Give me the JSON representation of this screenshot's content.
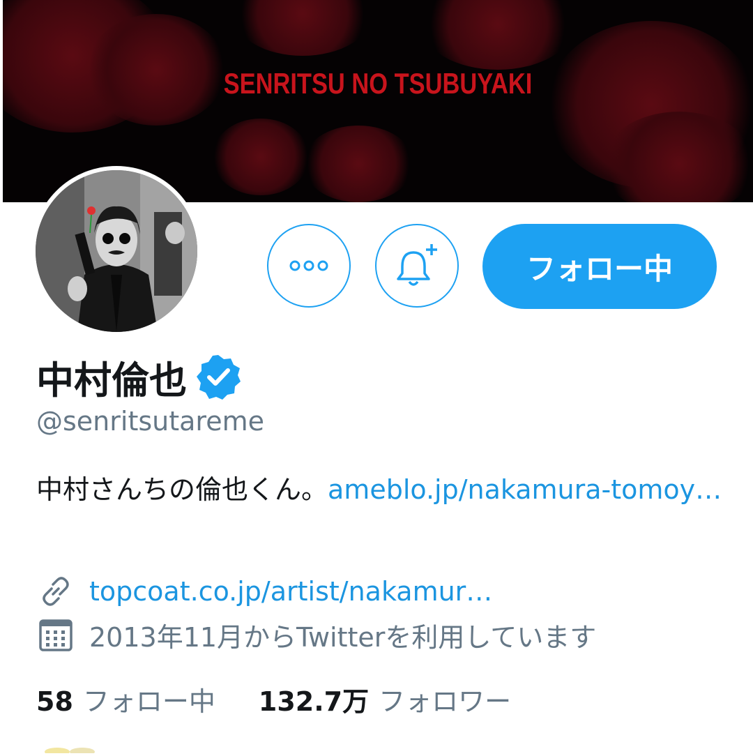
{
  "banner": {
    "title": "SENRITSU NO TSUBUYAKI"
  },
  "profile": {
    "name": "中村倫也",
    "handle": "@senritsutareme",
    "bio_text": "中村さんちの倫也くん。",
    "bio_link": "ameblo.jp/nakamura-tomoy…",
    "website": "topcoat.co.jp/artist/nakamur…",
    "joined": "2013年11月からTwitterを利用しています"
  },
  "actions": {
    "more_icon": "more-dots-icon",
    "notify_icon": "bell-plus-icon",
    "follow_label": "フォロー中"
  },
  "stats": {
    "following_count": "58",
    "following_label": "フォロー中",
    "followers_count": "132.7万",
    "followers_label": "フォロワー"
  },
  "colors": {
    "accent": "#1da1f2",
    "link": "#1b95e0",
    "secondary_text": "#657786",
    "banner_title": "#c8141c"
  }
}
